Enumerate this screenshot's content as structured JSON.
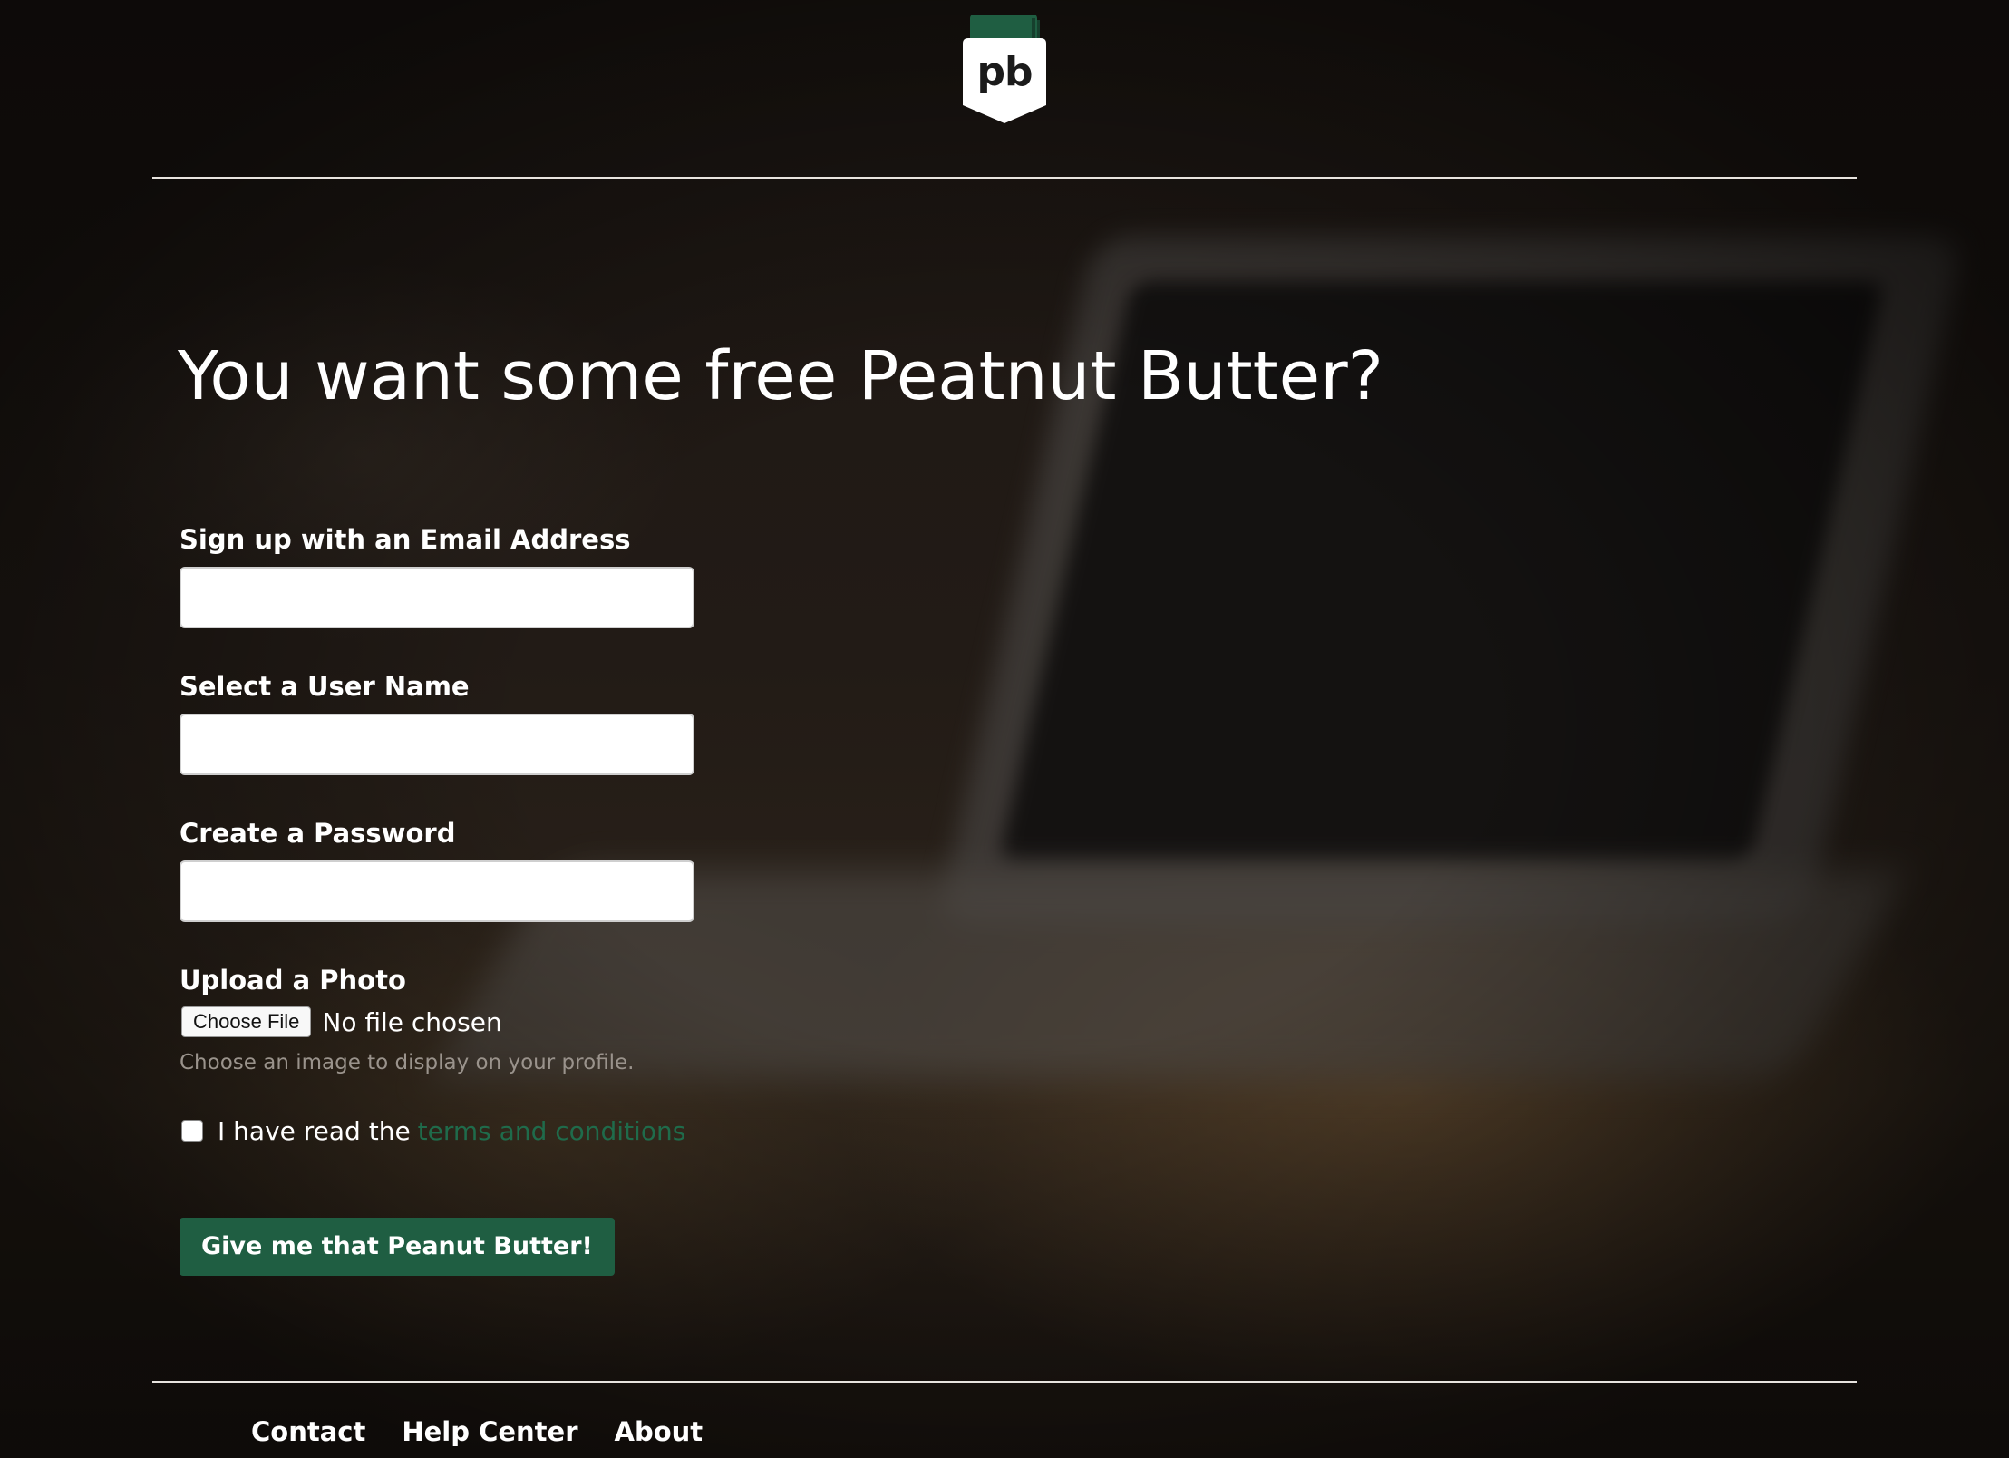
{
  "brand": {
    "logo_text": "pb",
    "logo_top_color": "#1f5e42",
    "logo_body_color": "#ffffff"
  },
  "page": {
    "headline": "You want some free Peatnut Butter?"
  },
  "form": {
    "email_label": "Sign up with an Email Address",
    "email_value": "",
    "username_label": "Select a User Name",
    "username_value": "",
    "password_label": "Create a Password",
    "password_value": "",
    "photo_label": "Upload a Photo",
    "file_button_label": "Choose File",
    "file_status": "No file chosen",
    "photo_help": "Choose an image to display on your profile.",
    "terms_checked": false,
    "terms_prefix": "I have read the",
    "terms_link": "terms and conditions",
    "submit_label": "Give me that Peanut Butter!"
  },
  "colors": {
    "accent_green": "#1f5e42",
    "link_green": "#1f6b4b"
  },
  "footer": {
    "links": [
      {
        "label": "Contact"
      },
      {
        "label": "Help Center"
      },
      {
        "label": "About"
      }
    ]
  }
}
